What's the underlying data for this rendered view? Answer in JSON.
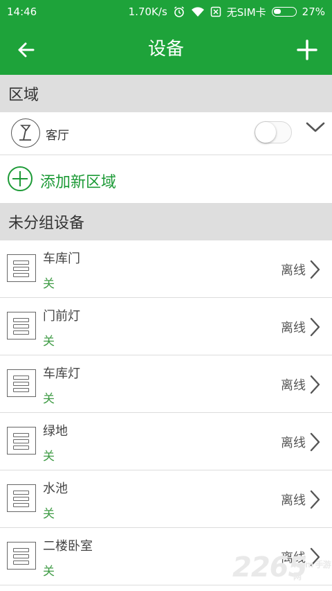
{
  "status_bar": {
    "time": "14:46",
    "speed": "1.70K/s",
    "sim": "无SIM卡",
    "battery": "27%"
  },
  "app_bar": {
    "title": "设备",
    "back_icon": "arrow-left-icon",
    "add_icon": "plus-icon"
  },
  "sections": {
    "region_header": "区域",
    "unassigned_header": "未分组设备"
  },
  "region": {
    "label": "客厅",
    "icon": "lamp-icon",
    "toggle_on": false
  },
  "add_region": {
    "label": "添加新区域"
  },
  "devices": [
    {
      "name": "车库门",
      "state": "关",
      "status": "离线"
    },
    {
      "name": "门前灯",
      "state": "关",
      "status": "离线"
    },
    {
      "name": "车库灯",
      "state": "关",
      "status": "离线"
    },
    {
      "name": "绿地",
      "state": "关",
      "status": "离线"
    },
    {
      "name": "水池",
      "state": "关",
      "status": "离线"
    },
    {
      "name": "二楼卧室",
      "state": "关",
      "status": "离线"
    }
  ],
  "watermark": {
    "main": "2265",
    "sub": ".com 手游网"
  },
  "colors": {
    "accent": "#1ea33a",
    "section_bg": "#dedede",
    "state_text": "#3f9b45"
  }
}
